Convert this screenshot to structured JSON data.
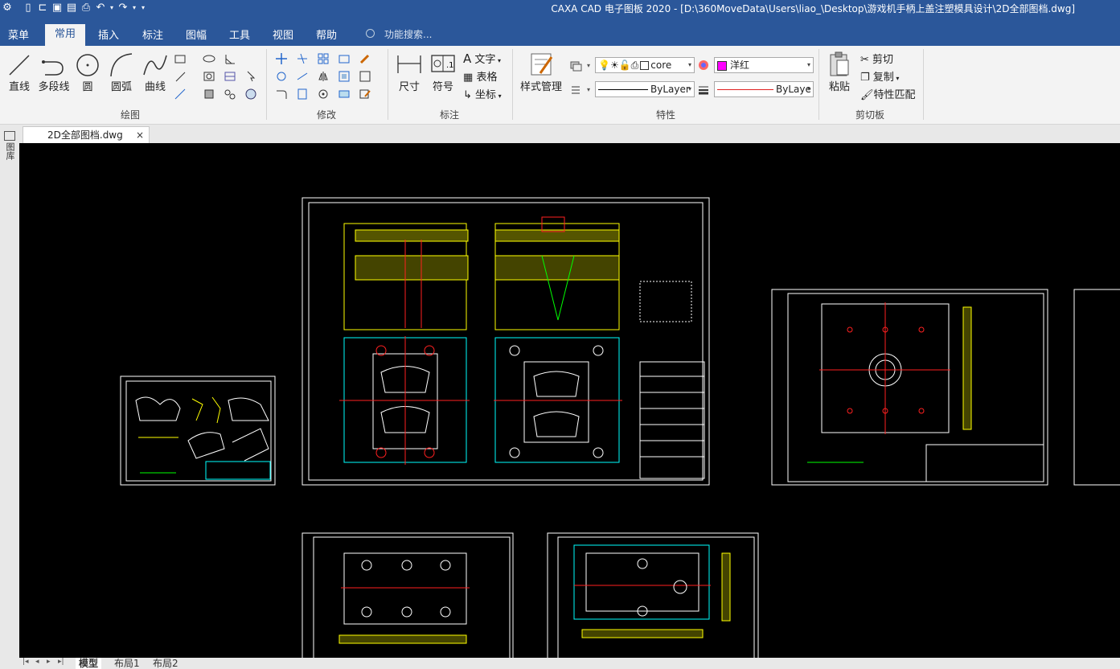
{
  "app": {
    "title": "CAXA CAD 电子图板 2020 - [D:\\360MoveData\\Users\\liao_\\Desktop\\游戏机手柄上盖注塑模具设计\\2D全部图档.dwg]"
  },
  "menu": {
    "items": [
      "菜单",
      "常用",
      "插入",
      "标注",
      "图幅",
      "工具",
      "视图",
      "帮助"
    ],
    "active": "常用",
    "search_placeholder": "功能搜索..."
  },
  "ribbon": {
    "draw": {
      "label": "绘图",
      "line": "直线",
      "polyline": "多段线",
      "circle": "圆",
      "arc": "圆弧",
      "curve": "曲线"
    },
    "modify": {
      "label": "修改"
    },
    "annotation": {
      "label": "标注",
      "dimension": "尺寸",
      "symbol": "符号",
      "text": "文字",
      "table": "表格",
      "coordinate": "坐标"
    },
    "properties": {
      "label": "特性",
      "style_manager": "样式管理",
      "layer_value": "core",
      "color_value": "洋红",
      "linetype_value": "ByLayer",
      "lineweight_value": "ByLaye"
    },
    "clipboard": {
      "label": "剪切板",
      "paste": "粘贴",
      "cut": "剪切",
      "copy": "复制",
      "match": "特性匹配"
    }
  },
  "doc_tab": {
    "name": "2D全部图档.dwg",
    "close": "×"
  },
  "sidebar": {
    "label": "图库"
  },
  "layout_tabs": [
    "模型",
    "布局1",
    "布局2"
  ],
  "colors": {
    "ribbon_blue": "#2b579a",
    "magenta": "#ff00ff",
    "cad_cyan": "#00ffff",
    "cad_green": "#00ff00",
    "cad_red": "#ff2020",
    "cad_yellow": "#ffff00"
  }
}
